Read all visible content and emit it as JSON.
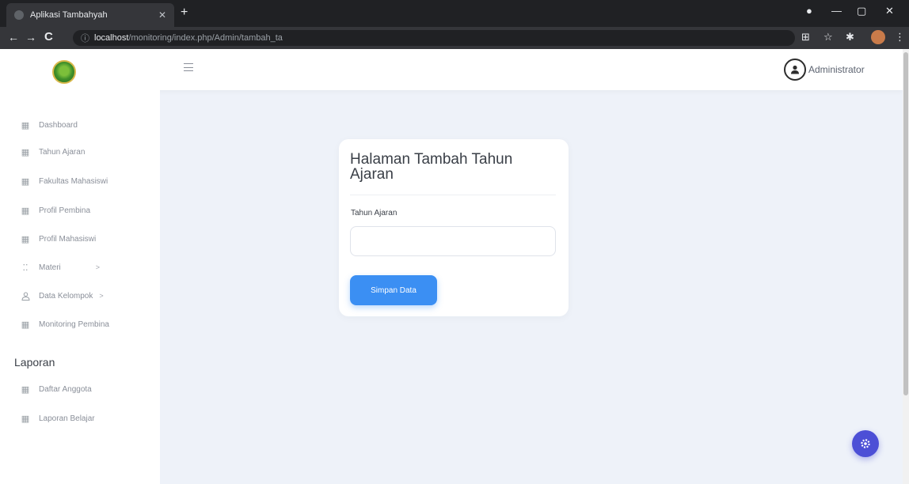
{
  "browser": {
    "tab_title": "Aplikasi Tambahyah",
    "address_host": "localhost",
    "address_path": "/monitoring/index.php/Admin/tambah_ta"
  },
  "header": {
    "user_name": "Administrator"
  },
  "sidebar": {
    "items": [
      {
        "label": "Dashboard",
        "icon": "grid-icon"
      },
      {
        "label": "Tahun Ajaran",
        "icon": "grid-icon"
      },
      {
        "label": "Fakultas Mahasiswi",
        "icon": "grid-icon"
      },
      {
        "label": "Profil Pembina",
        "icon": "grid-icon"
      },
      {
        "label": "Profil Mahasiswi",
        "icon": "grid-icon"
      },
      {
        "label": "Materi",
        "icon": "dots-icon",
        "has_submenu": true
      },
      {
        "label": "Data Kelompok",
        "icon": "user-icon",
        "has_submenu": true
      },
      {
        "label": "Monitoring Pembina",
        "icon": "grid-icon"
      }
    ],
    "section_heading": "Laporan",
    "report_items": [
      {
        "label": "Daftar Anggota",
        "icon": "grid-icon"
      },
      {
        "label": "Laporan Belajar",
        "icon": "grid-icon"
      }
    ]
  },
  "form": {
    "title": "Halaman Tambah Tahun Ajaran",
    "field_label": "Tahun Ajaran",
    "field_value": "",
    "submit_label": "Simpan Data"
  },
  "colors": {
    "primary": "#3b8ff3",
    "fab": "#4c4fd6",
    "background": "#eef2f9"
  }
}
